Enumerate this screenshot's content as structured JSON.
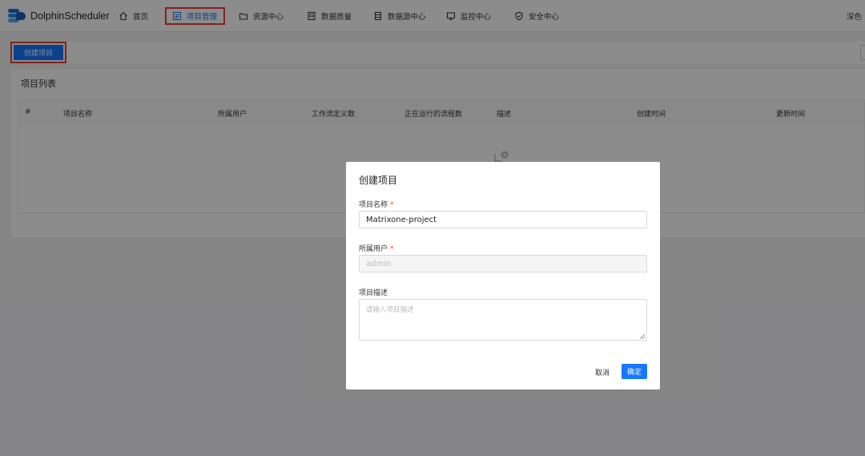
{
  "app": {
    "name": "DolphinScheduler"
  },
  "nav": {
    "items": [
      {
        "label": "首页",
        "icon": "home-icon"
      },
      {
        "label": "项目管理",
        "icon": "project-list-icon"
      },
      {
        "label": "资源中心",
        "icon": "folder-icon"
      },
      {
        "label": "数据质量",
        "icon": "data-quality-icon"
      },
      {
        "label": "数据源中心",
        "icon": "datasource-icon"
      },
      {
        "label": "监控中心",
        "icon": "monitor-icon"
      },
      {
        "label": "安全中心",
        "icon": "shield-icon"
      }
    ],
    "active_index": 1,
    "theme_label": "深色"
  },
  "toolbar": {
    "create_label": "创建项目"
  },
  "list": {
    "title": "项目列表",
    "columns": [
      "#",
      "项目名称",
      "所属用户",
      "工作流定义数",
      "正在运行的流程数",
      "描述",
      "创建时间",
      "更新时间"
    ],
    "rows": []
  },
  "modal": {
    "title": "创建项目",
    "name_label": "项目名称",
    "name_value": "Matrixone-project",
    "owner_label": "所属用户",
    "owner_value": "admin",
    "desc_label": "项目描述",
    "desc_placeholder": "请输入项目描述",
    "required_mark": "*",
    "cancel_label": "取消",
    "confirm_label": "确定"
  },
  "colors": {
    "primary": "#1677ff",
    "highlight": "#e8412f",
    "required": "#e8412f"
  }
}
